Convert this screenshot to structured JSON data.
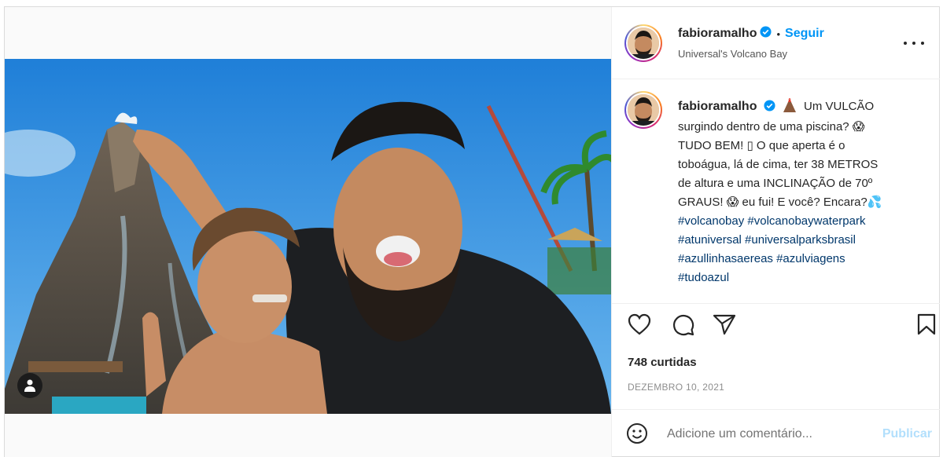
{
  "post": {
    "username": "fabioramalho",
    "separator": "•",
    "follow_label": "Seguir",
    "location": "Universal's Volcano Bay",
    "verified_icon": "verified-badge-icon"
  },
  "caption": {
    "username": "fabioramalho",
    "lines": [
      "Um VULCÃO",
      "surgindo dentro de uma piscina? 😱",
      "TUDO BEM! ▯ O que aperta é o",
      "toboágua, lá de cima, ter 38 METROS",
      "de altura e uma INCLINAÇÃO de 70º",
      "GRAUS! 😱 eu fui! E você? Encara?💦"
    ],
    "hashtag_lines": [
      "#volcanobay #volcanobaywaterpark",
      "#atuniversal #universalparksbrasil",
      "#azullinhasaereas #azulviagens",
      "#tudoazul"
    ],
    "emoji_icon": "volcano-icon"
  },
  "actions": {
    "like_icon": "heart-icon",
    "comment_icon": "comment-icon",
    "share_icon": "send-icon",
    "save_icon": "bookmark-icon"
  },
  "likes_text": "748 curtidas",
  "date_text": "DEZEMBRO 10, 2021",
  "comment": {
    "placeholder": "Adicione um comentário...",
    "publish_label": "Publicar",
    "emoji_icon": "smiley-icon"
  },
  "colors": {
    "accent": "#0095f6",
    "hashtag": "#00376b",
    "publish_disabled": "#b2dffc",
    "border": "#dbdbdb"
  }
}
